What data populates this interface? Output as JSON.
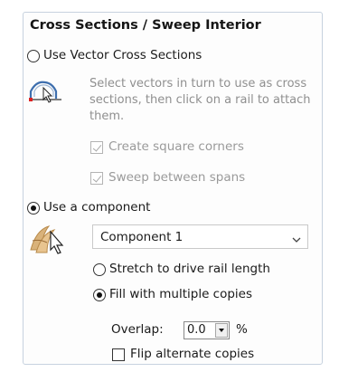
{
  "section": {
    "title": "Cross Sections / Sweep Interior"
  },
  "vector_option": {
    "label": "Use Vector Cross Sections",
    "selected": false,
    "description": "Select vectors in turn to use as cross sections, then click on a rail to attach them.",
    "icon": "cross-section-rail-icon",
    "square_corners": {
      "label": "Create square corners",
      "checked": true,
      "enabled": false
    },
    "sweep_spans": {
      "label": "Sweep between spans",
      "checked": true,
      "enabled": false
    }
  },
  "component_option": {
    "label": "Use a component",
    "selected": true,
    "icon": "component-cursor-icon",
    "dropdown": {
      "selected": "Component 1",
      "icon": "chevron-down-icon"
    },
    "stretch": {
      "label": "Stretch to drive rail length",
      "selected": false
    },
    "fill": {
      "label": "Fill with multiple copies",
      "selected": true
    },
    "overlap": {
      "label": "Overlap:",
      "value": "0.0",
      "unit": "%"
    },
    "flip": {
      "label": "Flip alternate copies",
      "checked": false
    }
  }
}
